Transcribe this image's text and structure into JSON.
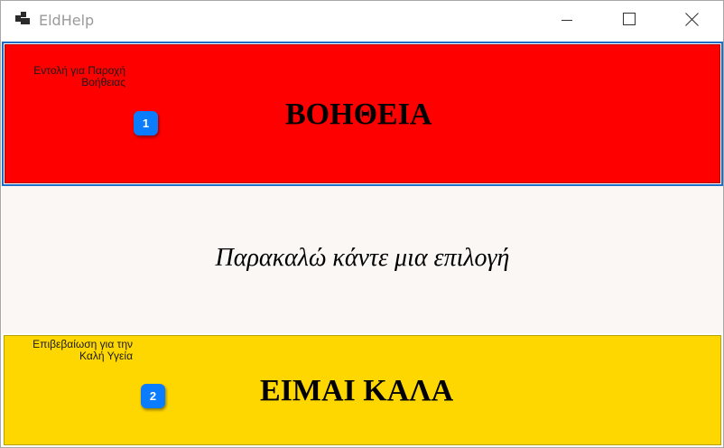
{
  "window": {
    "title": "EldHelp",
    "icons": {
      "app": "app-icon",
      "minimize": "minimize-icon",
      "maximize": "maximize-icon",
      "close": "close-icon"
    }
  },
  "help_button": {
    "label": "ΒΟΗΘΕΙΑ",
    "hint_line1": "Εντολή για Παροχή",
    "hint_line2": "Βοήθειας",
    "badge": "1",
    "color": "#ff0000"
  },
  "prompt": {
    "text": "Παρακαλώ κάντε μια επιλογή"
  },
  "ok_button": {
    "label": "ΕΙΜΑΙ ΚΑΛΑ",
    "hint_line1": "Επιβεβαίωση για την",
    "hint_line2": "Καλή Υγεία",
    "badge": "2",
    "color": "#ffd700"
  },
  "colors": {
    "badge": "#0a7cff",
    "focus_border": "#1e6ec8",
    "prompt_bg": "#fbf7f5"
  }
}
